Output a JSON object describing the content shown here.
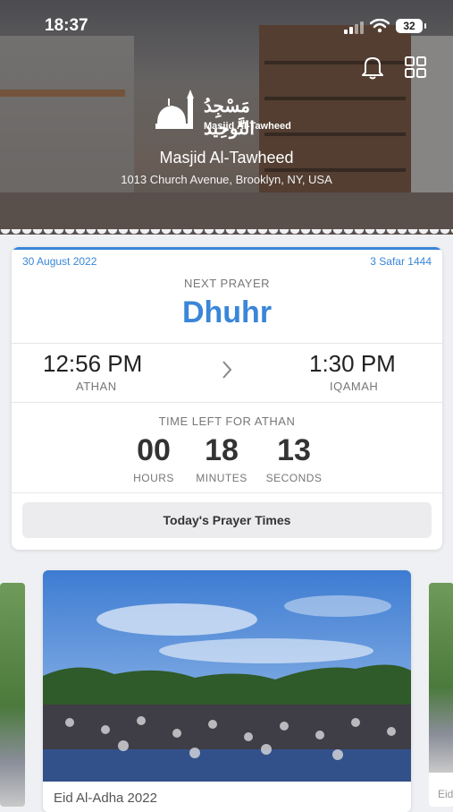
{
  "status_bar": {
    "time": "18:37",
    "battery": "32"
  },
  "header": {
    "logo_arabic": "مَسْجِدُ التَّوحِيد",
    "logo_latin": "Masjid Al-Tawheed",
    "masjid_name": "Masjid Al-Tawheed",
    "address": "1013 Church Avenue, Brooklyn, NY, USA",
    "icons": [
      "bell-icon",
      "grid-icon"
    ]
  },
  "prayer_card": {
    "gregorian_date": "30 August 2022",
    "hijri_date": "3 Safar 1444",
    "next_prayer_label": "NEXT PRAYER",
    "next_prayer_name": "Dhuhr",
    "athan_time": "12:56 PM",
    "athan_label": "ATHAN",
    "iqamah_time": "1:30 PM",
    "iqamah_label": "IQAMAH",
    "time_left_label": "TIME LEFT FOR ATHAN",
    "countdown": [
      {
        "value": "00",
        "label": "HOURS"
      },
      {
        "value": "18",
        "label": "MINUTES"
      },
      {
        "value": "13",
        "label": "SECONDS"
      }
    ],
    "button_label": "Today's Prayer Times",
    "accent_color": "#3a86d8"
  },
  "carousel": {
    "main_caption": "Eid Al-Adha 2022",
    "right_peek_caption": "Eid"
  }
}
